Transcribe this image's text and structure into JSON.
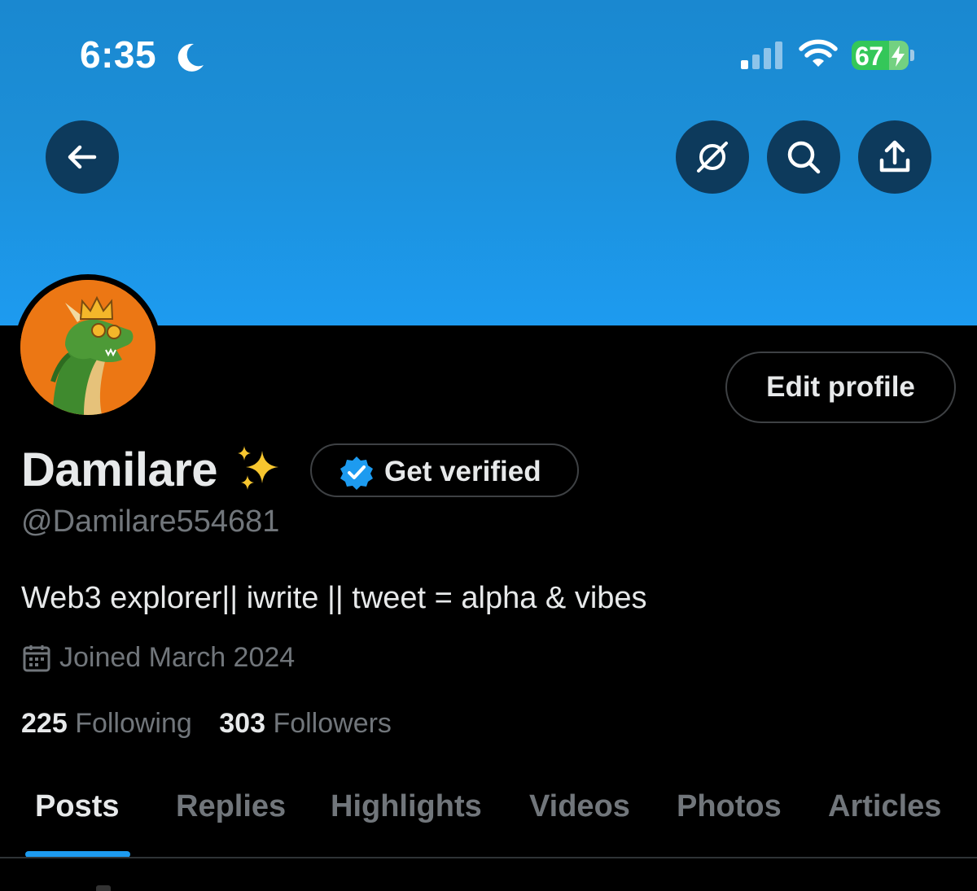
{
  "status_bar": {
    "time": "6:35",
    "battery_percent": "67",
    "icons": [
      "moon-icon",
      "signal-icon",
      "wifi-icon",
      "battery-icon"
    ]
  },
  "header": {
    "buttons": [
      "back-arrow-icon",
      "grok-icon",
      "search-icon",
      "share-icon"
    ],
    "banner_color": "#1d9bf0"
  },
  "profile": {
    "display_name": "Damilare",
    "name_emoji": "✨",
    "handle": "@Damilare554681",
    "bio": "Web3 explorer|| iwrite || tweet = alpha & vibes",
    "joined": "Joined March 2024",
    "edit_button": "Edit profile",
    "verify_button": "Get verified",
    "following_count": "225",
    "following_label": "Following",
    "followers_count": "303",
    "followers_label": "Followers",
    "avatar_bg": "#ec7714"
  },
  "tabs": [
    {
      "label": "Posts",
      "active": true
    },
    {
      "label": "Replies",
      "active": false
    },
    {
      "label": "Highlights",
      "active": false
    },
    {
      "label": "Videos",
      "active": false
    },
    {
      "label": "Photos",
      "active": false
    },
    {
      "label": "Articles",
      "active": false
    }
  ],
  "colors": {
    "accent": "#1d9bf0",
    "background": "#000000",
    "primary_text": "#e7e9ea",
    "secondary_text": "#71767b",
    "battery_green": "#34c759"
  }
}
